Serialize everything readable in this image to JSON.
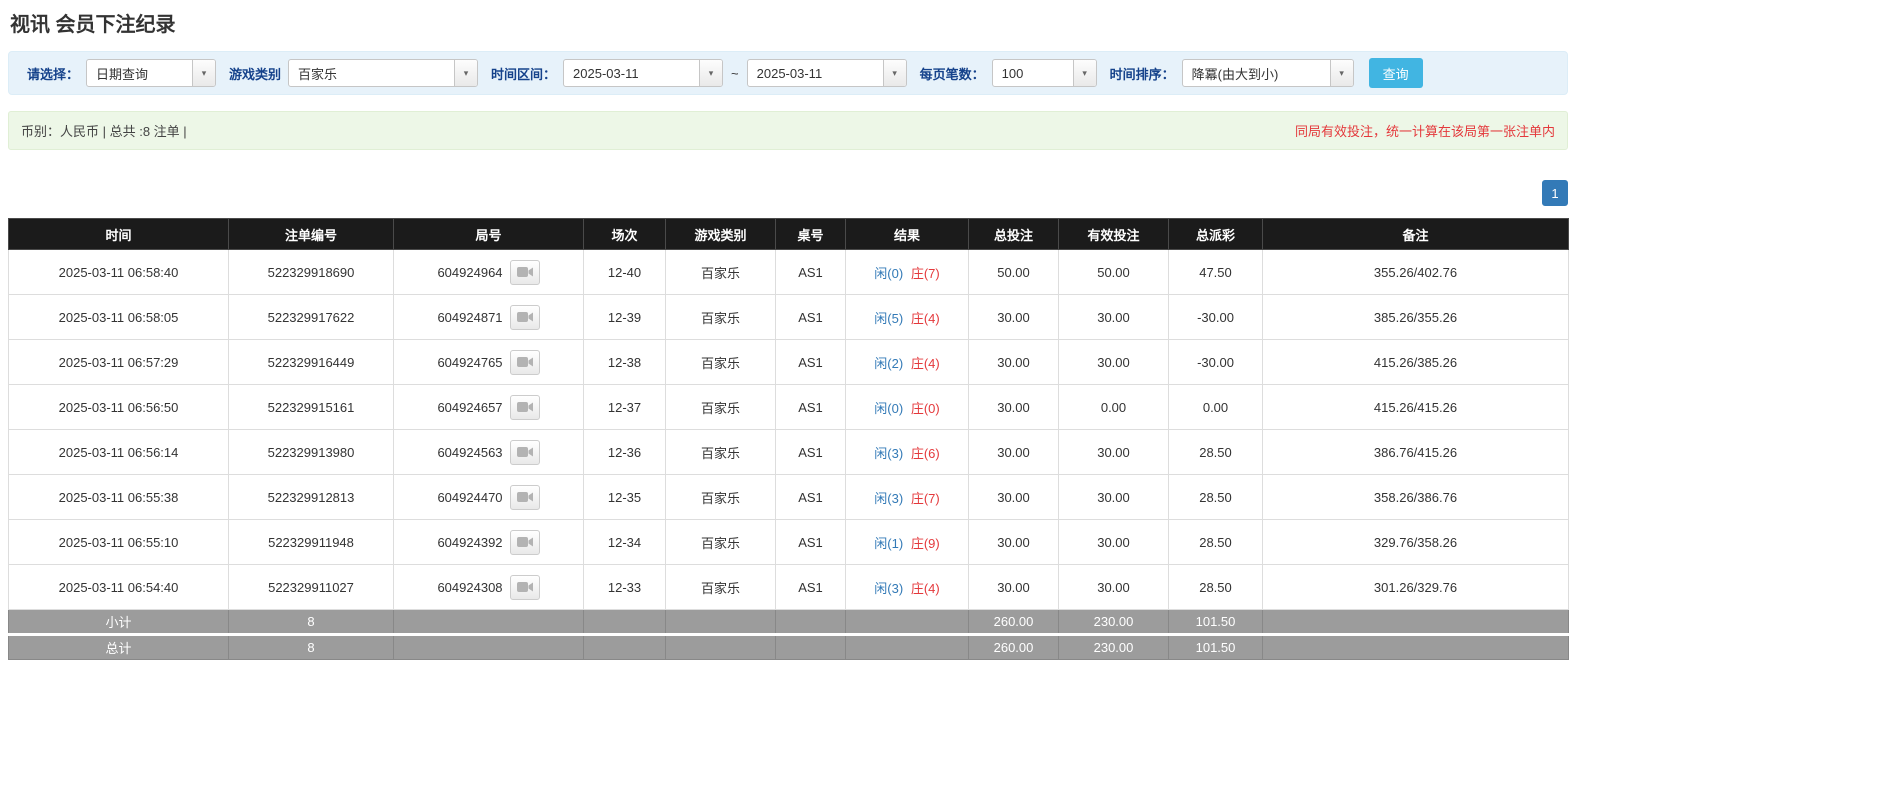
{
  "page": {
    "title": "视讯 会员下注纪录"
  },
  "filters": {
    "select_label": "请选择：",
    "select_value": "日期查询",
    "game_label": "游戏类别",
    "game_value": "百家乐",
    "range_label": "时间区间：",
    "date_from": "2025-03-11",
    "range_separator": "~",
    "date_to": "2025-03-11",
    "page_size_label": "每页笔数：",
    "page_size_value": "100",
    "sort_label": "时间排序：",
    "sort_value": "降冪(由大到小)",
    "search_label": "查询"
  },
  "summary": {
    "info": "币别：人民币 | 总共 :8 注单 |",
    "notice": "同局有效投注，统一计算在该局第一张注单内"
  },
  "pagination": {
    "current_page": "1"
  },
  "table": {
    "headers": [
      "时间",
      "注单编号",
      "局号",
      "场次",
      "游戏类别",
      "桌号",
      "结果",
      "总投注",
      "有效投注",
      "总派彩",
      "备注"
    ],
    "rows": [
      {
        "time": "2025-03-11 06:58:40",
        "bet_id": "522329918690",
        "round_id": "604924964",
        "session": "12-40",
        "game": "百家乐",
        "table_no": "AS1",
        "result_player": "闲(0)",
        "result_banker": "庄(7)",
        "total_bet": "50.00",
        "valid_bet": "50.00",
        "payout": "47.50",
        "remark": "355.26/402.76"
      },
      {
        "time": "2025-03-11 06:58:05",
        "bet_id": "522329917622",
        "round_id": "604924871",
        "session": "12-39",
        "game": "百家乐",
        "table_no": "AS1",
        "result_player": "闲(5)",
        "result_banker": "庄(4)",
        "total_bet": "30.00",
        "valid_bet": "30.00",
        "payout": "-30.00",
        "remark": "385.26/355.26"
      },
      {
        "time": "2025-03-11 06:57:29",
        "bet_id": "522329916449",
        "round_id": "604924765",
        "session": "12-38",
        "game": "百家乐",
        "table_no": "AS1",
        "result_player": "闲(2)",
        "result_banker": "庄(4)",
        "total_bet": "30.00",
        "valid_bet": "30.00",
        "payout": "-30.00",
        "remark": "415.26/385.26"
      },
      {
        "time": "2025-03-11 06:56:50",
        "bet_id": "522329915161",
        "round_id": "604924657",
        "session": "12-37",
        "game": "百家乐",
        "table_no": "AS1",
        "result_player": "闲(0)",
        "result_banker": "庄(0)",
        "total_bet": "30.00",
        "valid_bet": "0.00",
        "payout": "0.00",
        "remark": "415.26/415.26"
      },
      {
        "time": "2025-03-11 06:56:14",
        "bet_id": "522329913980",
        "round_id": "604924563",
        "session": "12-36",
        "game": "百家乐",
        "table_no": "AS1",
        "result_player": "闲(3)",
        "result_banker": "庄(6)",
        "total_bet": "30.00",
        "valid_bet": "30.00",
        "payout": "28.50",
        "remark": "386.76/415.26"
      },
      {
        "time": "2025-03-11 06:55:38",
        "bet_id": "522329912813",
        "round_id": "604924470",
        "session": "12-35",
        "game": "百家乐",
        "table_no": "AS1",
        "result_player": "闲(3)",
        "result_banker": "庄(7)",
        "total_bet": "30.00",
        "valid_bet": "30.00",
        "payout": "28.50",
        "remark": "358.26/386.76"
      },
      {
        "time": "2025-03-11 06:55:10",
        "bet_id": "522329911948",
        "round_id": "604924392",
        "session": "12-34",
        "game": "百家乐",
        "table_no": "AS1",
        "result_player": "闲(1)",
        "result_banker": "庄(9)",
        "total_bet": "30.00",
        "valid_bet": "30.00",
        "payout": "28.50",
        "remark": "329.76/358.26"
      },
      {
        "time": "2025-03-11 06:54:40",
        "bet_id": "522329911027",
        "round_id": "604924308",
        "session": "12-33",
        "game": "百家乐",
        "table_no": "AS1",
        "result_player": "闲(3)",
        "result_banker": "庄(4)",
        "total_bet": "30.00",
        "valid_bet": "30.00",
        "payout": "28.50",
        "remark": "301.26/329.76"
      }
    ],
    "subtotal": {
      "label": "小计",
      "count": "8",
      "total_bet": "260.00",
      "valid_bet": "230.00",
      "payout": "101.50"
    },
    "grand_total": {
      "label": "总计",
      "count": "8",
      "total_bet": "260.00",
      "valid_bet": "230.00",
      "payout": "101.50"
    }
  },
  "colors": {
    "accent_blue": "#337ab7",
    "banker_red": "#e4393c",
    "negative_red": "#e4393c",
    "header_bg": "#1b1b1b",
    "footer_bg": "#9c9c9c",
    "filter_bg": "#e7f2fa",
    "summary_bg": "#edf7e7",
    "search_button_bg": "#41b5e2"
  }
}
